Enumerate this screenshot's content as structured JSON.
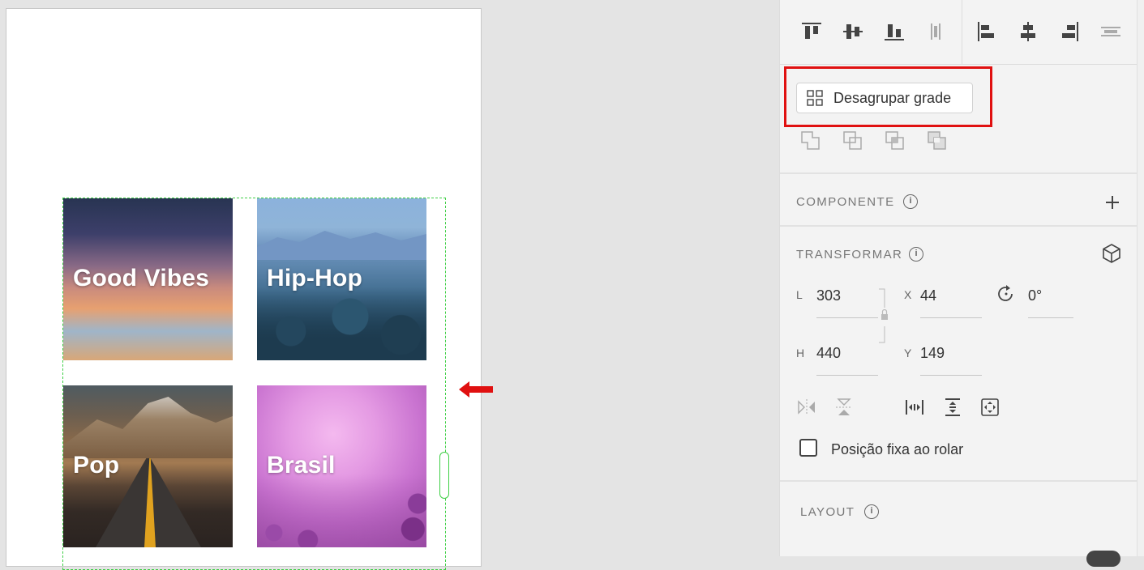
{
  "canvas": {
    "tiles": [
      {
        "label": "Good Vibes"
      },
      {
        "label": "Hip-Hop"
      },
      {
        "label": "Pop"
      },
      {
        "label": "Brasil"
      }
    ]
  },
  "panel": {
    "ungroup_label": "Desagrupar grade",
    "component": {
      "title": "COMPONENTE"
    },
    "transform": {
      "title": "TRANSFORMAR",
      "width_label": "L",
      "width_value": "303",
      "height_label": "H",
      "height_value": "440",
      "x_label": "X",
      "x_value": "44",
      "y_label": "Y",
      "y_value": "149",
      "rotation_value": "0°"
    },
    "fixed_position_label": "Posição fixa ao rolar",
    "layout": {
      "title": "LAYOUT"
    }
  },
  "colors": {
    "highlight": "#e01010",
    "selection": "#3fcf45"
  }
}
